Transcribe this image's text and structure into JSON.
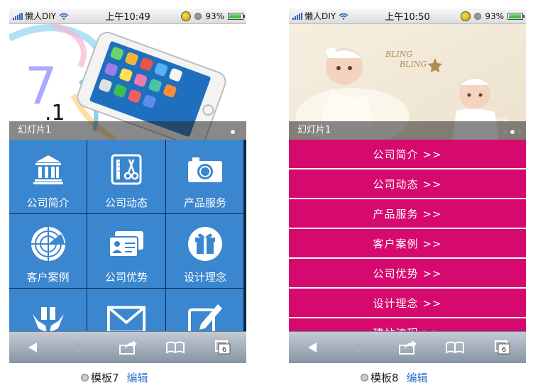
{
  "status_left": {
    "carrier": "懒人DIY",
    "time": "上午10:49",
    "battery": "93%"
  },
  "status_right": {
    "carrier": "懒人DIY",
    "time": "上午10:50",
    "battery": "93%"
  },
  "slide_left": {
    "caption": "幻灯片1",
    "big_digit": "7",
    "small_digit": ".1"
  },
  "slide_right": {
    "caption": "幻灯片1",
    "overlay_text_1": "BLING",
    "overlay_text_2": "BLING",
    "watermark": "拉手网"
  },
  "grid": [
    {
      "label": "公司简介",
      "icon": "bank-icon"
    },
    {
      "label": "公司动态",
      "icon": "scissors-doc-icon"
    },
    {
      "label": "产品服务",
      "icon": "camera-icon"
    },
    {
      "label": "客户案例",
      "icon": "radar-icon"
    },
    {
      "label": "公司优势",
      "icon": "id-card-icon"
    },
    {
      "label": "设计理念",
      "icon": "gift-icon"
    },
    {
      "label": "",
      "icon": "hands-gift-icon"
    },
    {
      "label": "",
      "icon": "mail-icon"
    },
    {
      "label": "",
      "icon": "pencil-note-icon"
    }
  ],
  "list": [
    "公司简介 >>",
    "公司动态 >>",
    "产品服务 >>",
    "客户案例 >>",
    "公司优势 >>",
    "设计理念 >>",
    "建站流程 >>"
  ],
  "toolbar": {
    "tabs_count": "6"
  },
  "captions": {
    "left": {
      "name": "模板7",
      "edit": "编辑"
    },
    "right": {
      "name": "模板8",
      "edit": "编辑"
    }
  },
  "colors": {
    "grid_tile": "#3a86cf",
    "list_item": "#d6096e",
    "link": "#2e73c9"
  }
}
